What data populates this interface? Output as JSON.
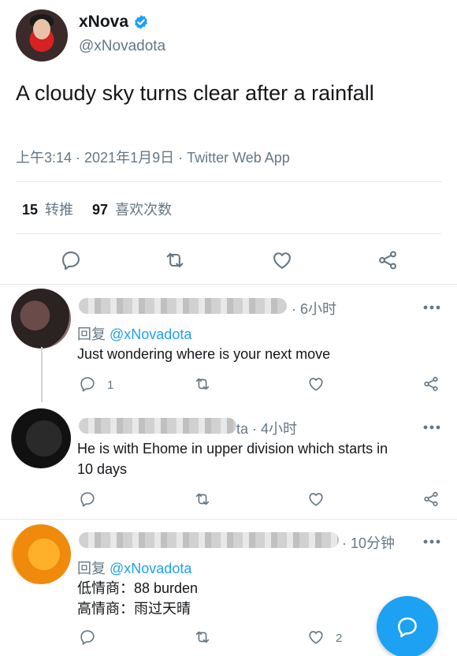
{
  "tweet": {
    "display_name": "xNova",
    "handle": "@xNovadota",
    "text": "A cloudy sky turns clear after a rainfall",
    "meta": "上午3:14 · 2021年1月9日 · Twitter Web App",
    "retweets_count": "15",
    "retweets_label": "转推",
    "likes_count": "97",
    "likes_label": "喜欢次数"
  },
  "icons": {
    "verified": "verified-badge-icon",
    "reply": "reply-icon",
    "retweet": "retweet-icon",
    "like": "heart-icon",
    "share": "share-icon",
    "more": "more-icon",
    "compose": "compose-reply-icon"
  },
  "colors": {
    "accent": "#1da1f2",
    "muted": "#657786",
    "text": "#14171a",
    "divider": "#e1e8ed"
  },
  "replies": [
    {
      "time": "· 6小时",
      "replying_prefix": "回复",
      "replying_handle": "@xNovadota",
      "lines": [
        "Just wondering where is your next move"
      ],
      "reply_count": "1",
      "like_count": ""
    },
    {
      "time": "ta · 4小时",
      "replying_prefix": "",
      "replying_handle": "",
      "lines": [
        "He is with Ehome in upper division which starts in",
        "10 days"
      ],
      "reply_count": "",
      "like_count": ""
    },
    {
      "time": "· 10分钟",
      "replying_prefix": "回复",
      "replying_handle": "@xNovadota",
      "lines": [
        "低情商：88 burden",
        "高情商：雨过天晴"
      ],
      "reply_count": "",
      "like_count": "2"
    }
  ]
}
